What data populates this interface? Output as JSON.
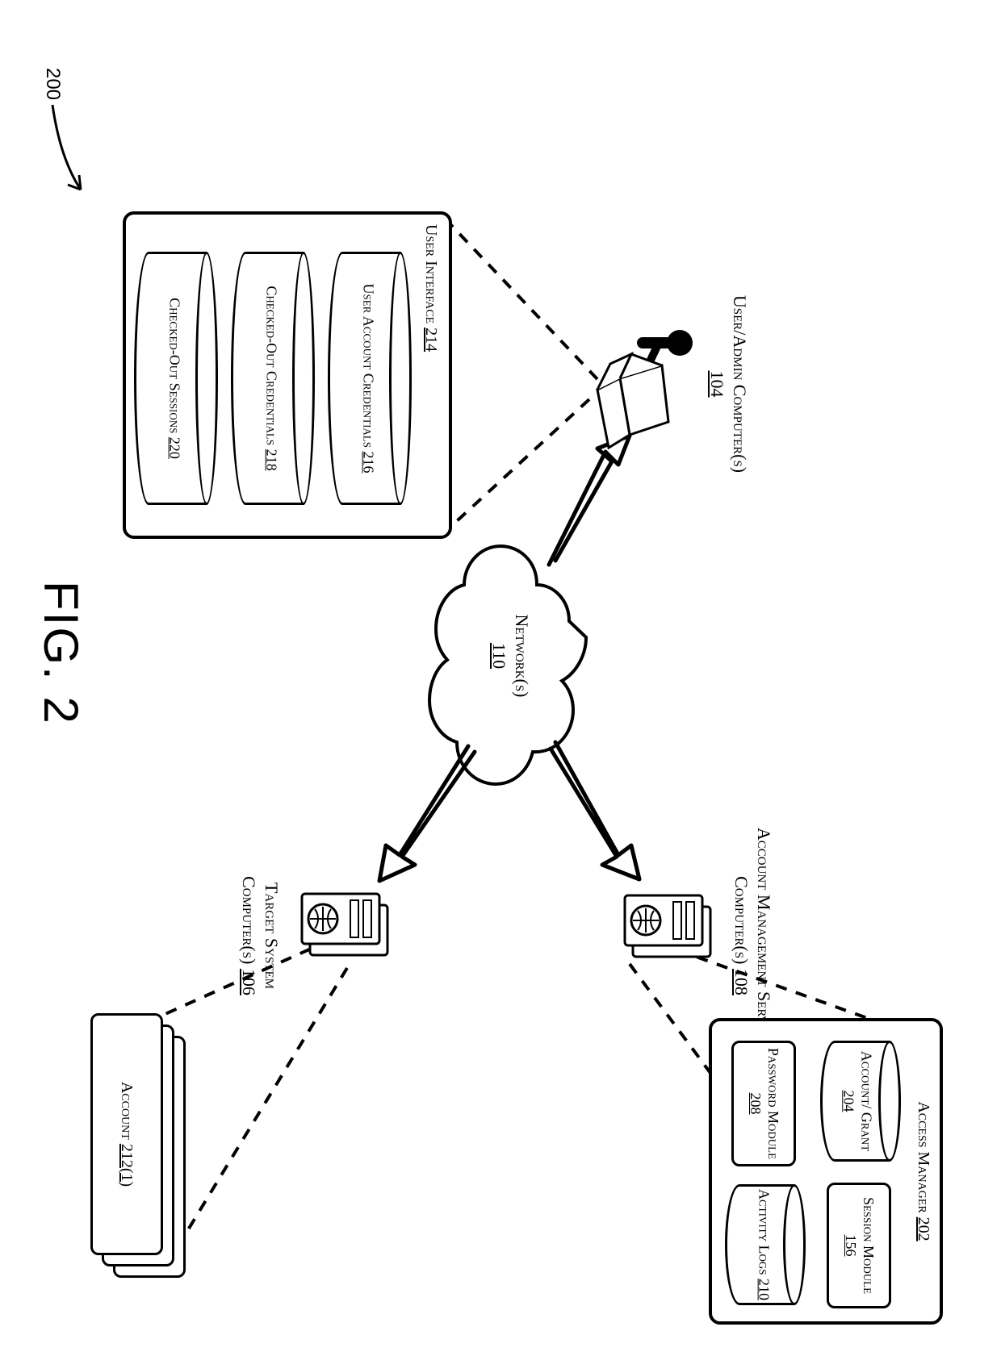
{
  "figure": {
    "caption": "FIG. 2",
    "ref": "200"
  },
  "network": {
    "label": "Network(s)",
    "ref": "110"
  },
  "nodes": {
    "user_admin": {
      "label": "User/Admin Computer(s)",
      "ref": "104"
    },
    "ams": {
      "label": "Account Management Service Computer(s)",
      "ref": "108"
    },
    "target": {
      "label": "Target System Computer(s)",
      "ref": "106"
    }
  },
  "access_manager": {
    "title": "Access Manager",
    "ref": "202",
    "account_grant": {
      "label": "Account/ Grant",
      "ref": "204"
    },
    "session_module": {
      "label": "Session Module",
      "ref": "156"
    },
    "password_module": {
      "label": "Password Module",
      "ref": "208"
    },
    "activity_logs": {
      "label": "Activity Logs",
      "ref": "210"
    }
  },
  "account_card": {
    "label": "Account",
    "ref": "212(1)"
  },
  "user_interface": {
    "title": "User Interface",
    "ref": "214",
    "user_creds": {
      "label": "User Account Credentials",
      "ref": "216"
    },
    "co_creds": {
      "label": "Checked-Out Credentials",
      "ref": "218"
    },
    "co_sess": {
      "label": "Checked-Out Sessions",
      "ref": "220"
    }
  }
}
